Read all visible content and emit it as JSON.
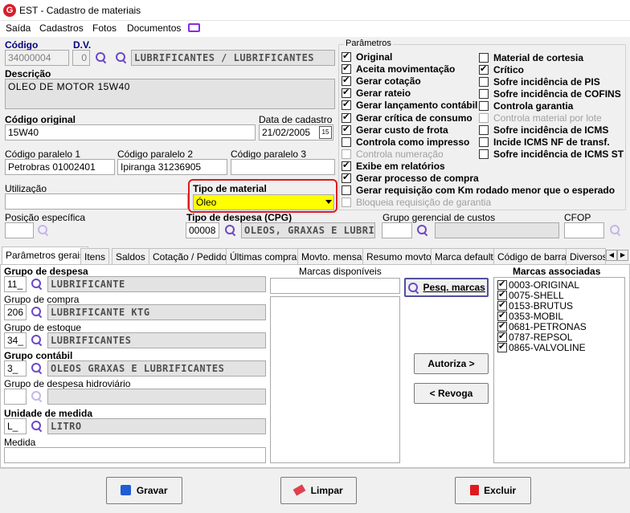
{
  "window": {
    "title": "EST - Cadastro de materiais",
    "logo": "G"
  },
  "menu": [
    "Saída",
    "Cadastros",
    "Fotos",
    "Documentos"
  ],
  "header": {
    "codigo_label": "Código",
    "codigo_value": "34000004",
    "dv_label": "D.V.",
    "dv_value": "0",
    "material_group": "LUBRIFICANTES / LUBRIFICANTES",
    "descricao_label": "Descrição",
    "descricao_value": "OLEO DE MOTOR 15W40",
    "codigo_original_label": "Código original",
    "codigo_original_value": "15W40",
    "data_cadastro_label": "Data de cadastro",
    "data_cadastro_value": "21/02/2005",
    "paralelo1_label": "Código paralelo 1",
    "paralelo1_value": "Petrobras  01002401",
    "paralelo2_label": "Código paralelo 2",
    "paralelo2_value": "Ipiranga 31236905",
    "paralelo3_label": "Código paralelo 3",
    "paralelo3_value": "",
    "utilizacao_label": "Utilização",
    "utilizacao_value": "",
    "tipo_material_label": "Tipo de material",
    "tipo_material_value": "Óleo",
    "posicao_label": "Posição específica",
    "posicao_value": "",
    "tipo_despesa_label": "Tipo de despesa (CPG)",
    "tipo_despesa_code": "00008",
    "tipo_despesa_desc": "OLEOS, GRAXAS E LUBRIF",
    "grupo_gerencial_label": "Grupo gerencial de custos",
    "grupo_gerencial_code": "",
    "grupo_gerencial_desc": "",
    "cfop_label": "CFOP",
    "cfop_value": ""
  },
  "parametros": {
    "title": "Parâmetros",
    "left": [
      {
        "label": "Original",
        "checked": true,
        "enabled": true
      },
      {
        "label": "Aceita movimentação",
        "checked": true,
        "enabled": true
      },
      {
        "label": "Gerar cotação",
        "checked": true,
        "enabled": true
      },
      {
        "label": "Gerar rateio",
        "checked": true,
        "enabled": true
      },
      {
        "label": "Gerar lançamento contábil",
        "checked": true,
        "enabled": true
      },
      {
        "label": "Gerar crítica de consumo",
        "checked": true,
        "enabled": true
      },
      {
        "label": "Gerar custo de frota",
        "checked": true,
        "enabled": true
      },
      {
        "label": "Controla como impresso",
        "checked": false,
        "enabled": true
      },
      {
        "label": "Controla numeração",
        "checked": false,
        "enabled": false
      },
      {
        "label": "Exibe em relatórios",
        "checked": true,
        "enabled": true
      },
      {
        "label": "Gerar processo de compra",
        "checked": true,
        "enabled": true
      },
      {
        "label": "Gerar requisição com Km rodado menor que o esperado",
        "checked": false,
        "enabled": true
      },
      {
        "label": "Bloqueia requisição de garantia",
        "checked": false,
        "enabled": false
      }
    ],
    "right": [
      {
        "label": "Material de cortesia",
        "checked": false,
        "enabled": true
      },
      {
        "label": "Crítico",
        "checked": true,
        "enabled": true
      },
      {
        "label": "Sofre incidência de PIS",
        "checked": false,
        "enabled": true
      },
      {
        "label": "Sofre incidência de COFINS",
        "checked": false,
        "enabled": true
      },
      {
        "label": "Controla garantia",
        "checked": false,
        "enabled": true
      },
      {
        "label": "Controla material por lote",
        "checked": false,
        "enabled": false
      },
      {
        "label": "Sofre incidência de ICMS",
        "checked": false,
        "enabled": true
      },
      {
        "label": "Incide ICMS NF de transf.",
        "checked": false,
        "enabled": true
      },
      {
        "label": "Sofre incidência de ICMS ST",
        "checked": false,
        "enabled": true
      }
    ]
  },
  "tabs": [
    "Parâmetros gerais",
    "Itens",
    "Saldos",
    "Cotação / Pedido",
    "Últimas compras",
    "Movto. mensal",
    "Resumo movto.",
    "Marca default",
    "Código de barras",
    "Diversos"
  ],
  "panel": {
    "grupo_despesa_label": "Grupo de despesa",
    "grupo_despesa_code": "11_",
    "grupo_despesa_desc": "LUBRIFICANTE",
    "grupo_compra_label": "Grupo de compra",
    "grupo_compra_code": "206",
    "grupo_compra_desc": "LUBRIFICANTE KTG",
    "grupo_estoque_label": "Grupo de estoque",
    "grupo_estoque_code": "34_",
    "grupo_estoque_desc": "LUBRIFICANTES",
    "grupo_contabil_label": "Grupo contábil",
    "grupo_contabil_code": "3_",
    "grupo_contabil_desc": "OLEOS GRAXAS E LUBRIFICANTES",
    "grupo_hidro_label": "Grupo de despesa hidroviário",
    "grupo_hidro_code": "",
    "grupo_hidro_desc": "",
    "unidade_label": "Unidade de medida",
    "unidade_code": "L_",
    "unidade_desc": "LITRO",
    "medida_label": "Medida",
    "medida_value": "",
    "marcas_disp_label": "Marcas disponíveis",
    "marcas_disp_search": "",
    "pesq_label": "Pesq. marcas",
    "autoriza_label": "Autoriza >",
    "revoga_label": "< Revoga",
    "marcas_assoc_label": "Marcas associadas",
    "marcas_assoc": [
      "0003-ORIGINAL",
      "0075-SHELL",
      "0153-BRUTUS",
      "0353-MOBIL",
      "0681-PETRONAS",
      "0787-REPSOL",
      "0865-VALVOLINE"
    ]
  },
  "footer": {
    "gravar": "Gravar",
    "limpar": "Limpar",
    "excluir": "Excluir"
  }
}
